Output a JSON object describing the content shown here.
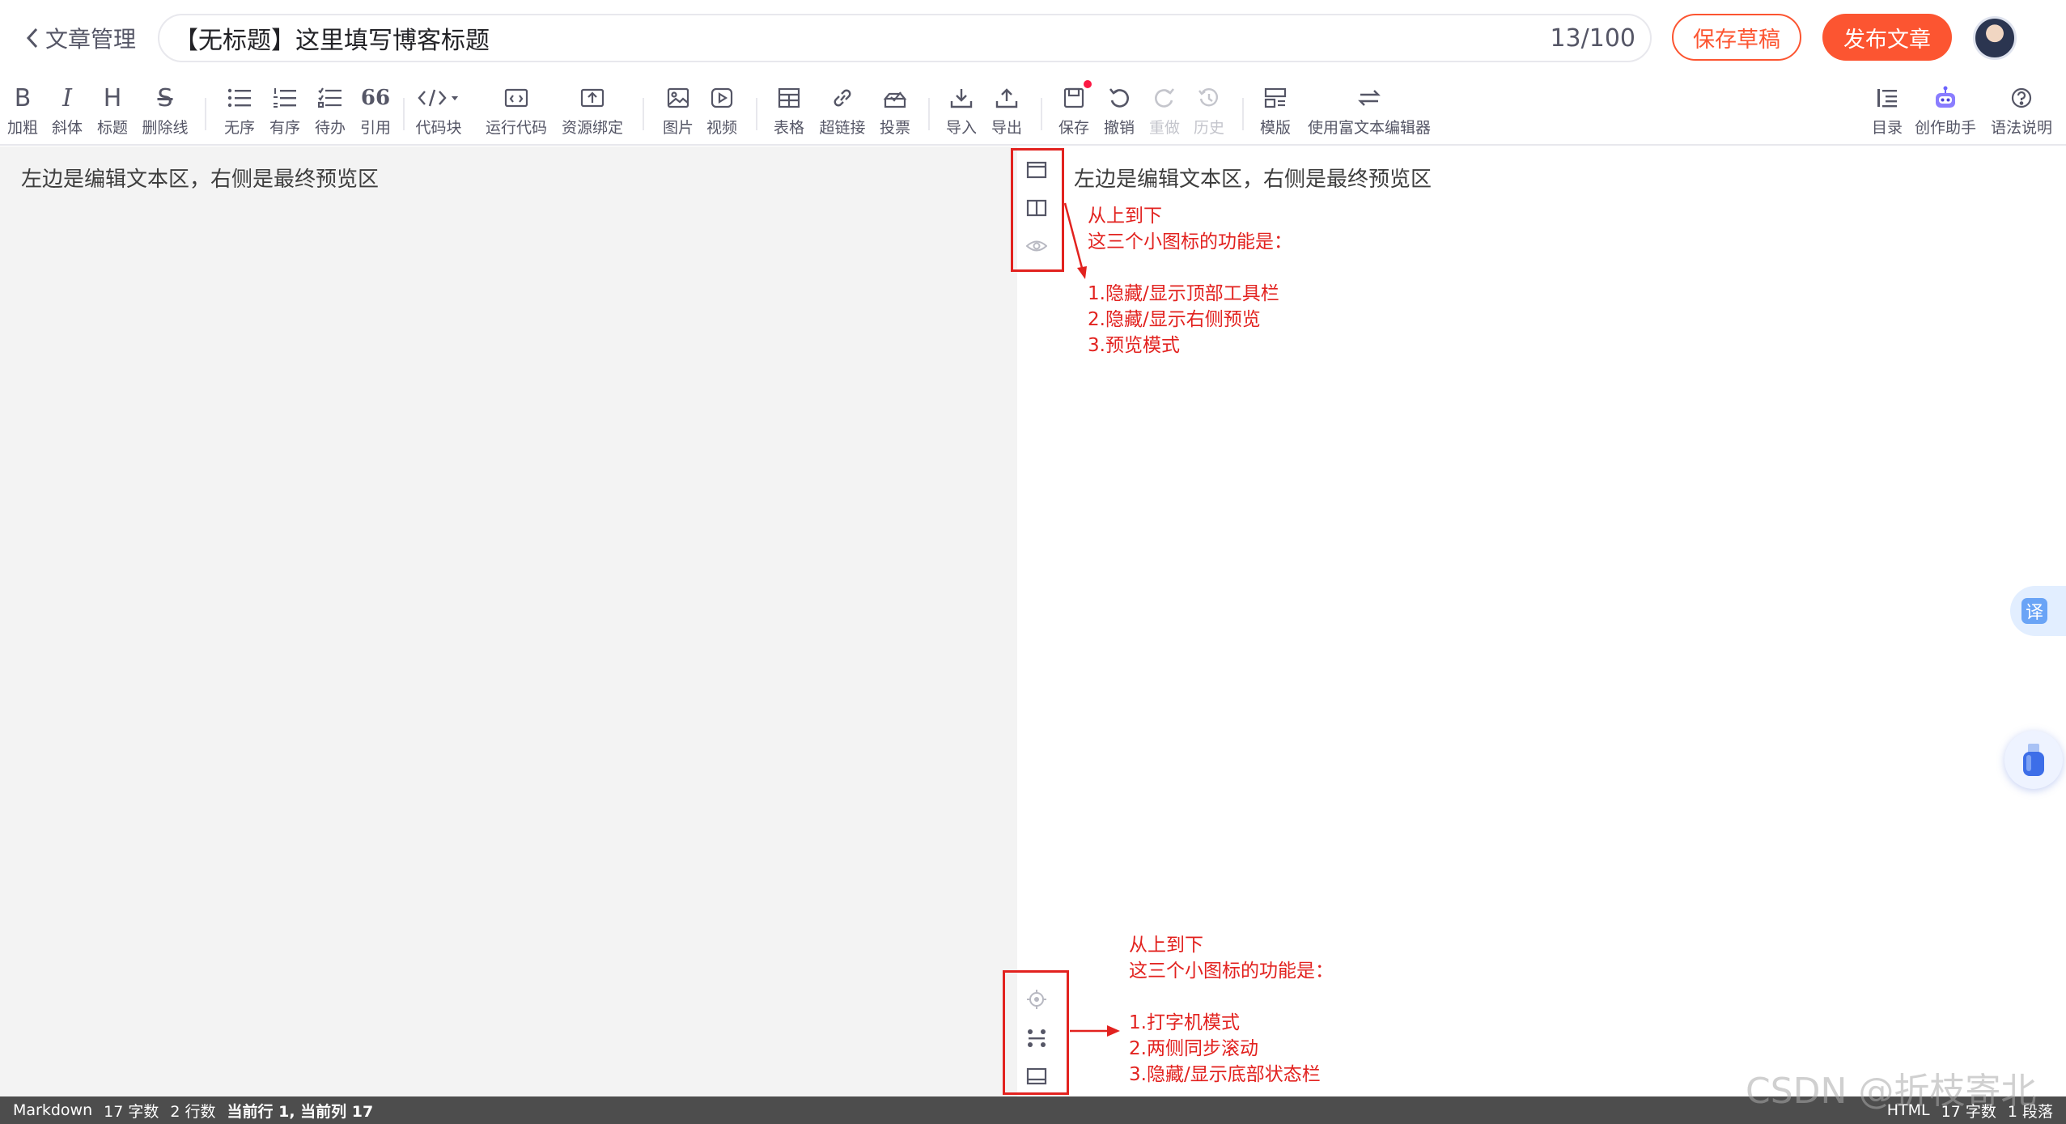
{
  "header": {
    "back_label": "文章管理",
    "title_value": "【无标题】这里填写博客标题",
    "title_count": "13/100",
    "save_draft_label": "保存草稿",
    "publish_label": "发布文章"
  },
  "toolbar": {
    "bold": "加粗",
    "italic": "斜体",
    "heading": "标题",
    "strike": "删除线",
    "ul": "无序",
    "ol": "有序",
    "todo": "待办",
    "quote": "引用",
    "codeblock": "代码块",
    "runcode": "运行代码",
    "resource": "资源绑定",
    "image": "图片",
    "video": "视频",
    "table": "表格",
    "link": "超链接",
    "vote": "投票",
    "import": "导入",
    "export": "导出",
    "save": "保存",
    "undo": "撤销",
    "redo": "重做",
    "history": "历史",
    "template": "模版",
    "richtext": "使用富文本编辑器",
    "toc": "目录",
    "assistant": "创作助手",
    "syntax": "语法说明",
    "icons": {
      "bold": "B",
      "italic": "I",
      "heading": "H",
      "strike": "S",
      "quote": "66"
    }
  },
  "editor": {
    "text": "左边是编辑文本区，右侧是最终预览区"
  },
  "preview": {
    "text": "左边是编辑文本区，右侧是最终预览区"
  },
  "annotations": {
    "top": {
      "line1": "从上到下",
      "line2": "这三个小图标的功能是：",
      "item1": "1.隐藏/显示顶部工具栏",
      "item2": "2.隐藏/显示右侧预览",
      "item3": "3.预览模式"
    },
    "bottom": {
      "line1": "从上到下",
      "line2": "这三个小图标的功能是：",
      "item1": "1.打字机模式",
      "item2": "2.两侧同步滚动",
      "item3": "3.隐藏/显示底部状态栏"
    },
    "color": "#e2221f"
  },
  "floating": {
    "translate_label": "译"
  },
  "statusbar": {
    "mode": "Markdown",
    "chars": "17 字数",
    "lines": "2 行数",
    "cursor": "当前行 1, 当前列 17",
    "right_mode": "HTML",
    "right_chars": "17 字数",
    "right_paras": "1 段落"
  },
  "watermark": "CSDN @折枝寄北",
  "colors": {
    "accent": "#fc5531",
    "editor_bg": "#f3f3f3",
    "statusbar_bg": "#4d4d4d",
    "annotation": "#e2221f"
  }
}
